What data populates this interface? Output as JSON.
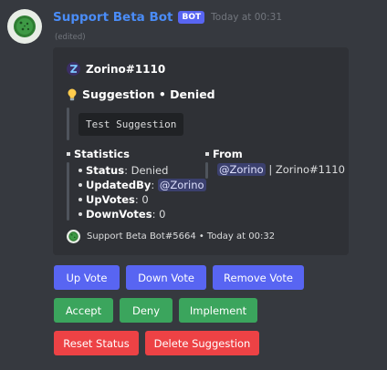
{
  "message": {
    "username": "Support Beta Bot",
    "badge": "BOT",
    "timestamp": "Today at 00:31",
    "edited": "(edited)"
  },
  "embed": {
    "author": "Zorino#1110",
    "title_suffix": "Suggestion • Denied",
    "description": "Test Suggestion",
    "fields": {
      "statistics": {
        "name": "Statistics",
        "items": [
          {
            "key": "Status",
            "value": "Denied"
          },
          {
            "key": "UpdatedBy",
            "mention": "@Zorino"
          },
          {
            "key": "UpVotes",
            "value": "0"
          },
          {
            "key": "DownVotes",
            "value": "0"
          }
        ]
      },
      "from": {
        "name": "From",
        "mention": "@Zorino",
        "rest": "| Zorino#1110"
      }
    },
    "footer": "Support Beta Bot#5664 • Today at 00:32"
  },
  "buttons": {
    "row1": [
      "Up Vote",
      "Down Vote",
      "Remove Vote"
    ],
    "row2": [
      "Accept",
      "Deny",
      "Implement"
    ],
    "row3": [
      "Reset Status",
      "Delete Suggestion"
    ]
  },
  "colors": {
    "background": "#36393f",
    "embed": "#2f3136",
    "username": "#4a8cf7",
    "blurple": "#5865f2",
    "green": "#3ba55d",
    "red": "#ed4245"
  }
}
